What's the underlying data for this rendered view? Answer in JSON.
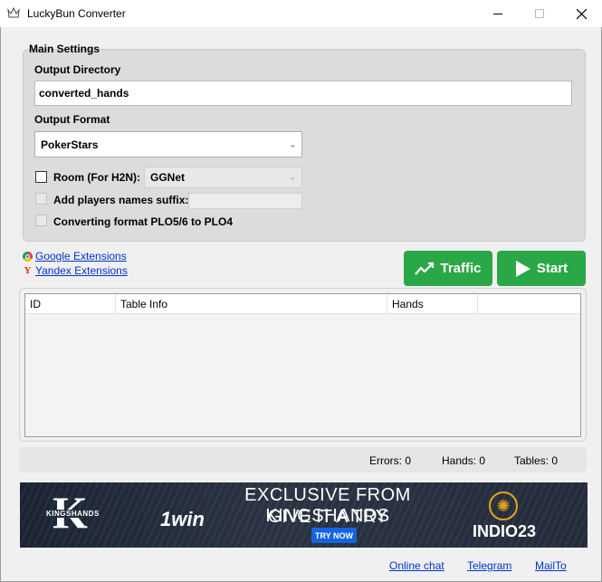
{
  "window": {
    "title": "LuckyBun Converter",
    "minimize_glyph": "—",
    "maximize_glyph": "☐",
    "close_glyph": "✕"
  },
  "main_settings": {
    "group_title": "Main Settings",
    "output_directory_label": "Output Directory",
    "output_directory_value": "converted_hands",
    "output_format_label": "Output Format",
    "output_format_value": "PokerStars",
    "room_label": "Room (For H2N):",
    "room_checked": false,
    "room_value": "GGNet",
    "suffix_label": "Add players names suffix:",
    "suffix_value": "",
    "plo_label": "Converting format PLO5/6 to PLO4"
  },
  "links": {
    "google": "Google Extensions",
    "yandex": "Yandex Extensions"
  },
  "buttons": {
    "traffic": "Traffic",
    "start": "Start"
  },
  "table": {
    "columns": [
      "ID",
      "Table Info",
      "Hands"
    ]
  },
  "status": {
    "errors": "Errors: 0",
    "hands": "Hands: 0",
    "tables": "Tables: 0"
  },
  "banner": {
    "brand": "KINGSHANDS",
    "brand_initial": "K",
    "partner": "1win",
    "headline": "EXCLUSIVE FROM KINGSHANDS",
    "subline": "GIVE IT A TRY",
    "cta": "TRY NOW",
    "promo": "INDIO23"
  },
  "footer": {
    "online_chat": "Online chat",
    "telegram": "Telegram",
    "mailto": "MailTo"
  },
  "colors": {
    "accent_green": "#2aa847",
    "link_blue": "#0033cc",
    "banner_bg": "#252d3d",
    "promo_gold": "#e8a21f"
  }
}
